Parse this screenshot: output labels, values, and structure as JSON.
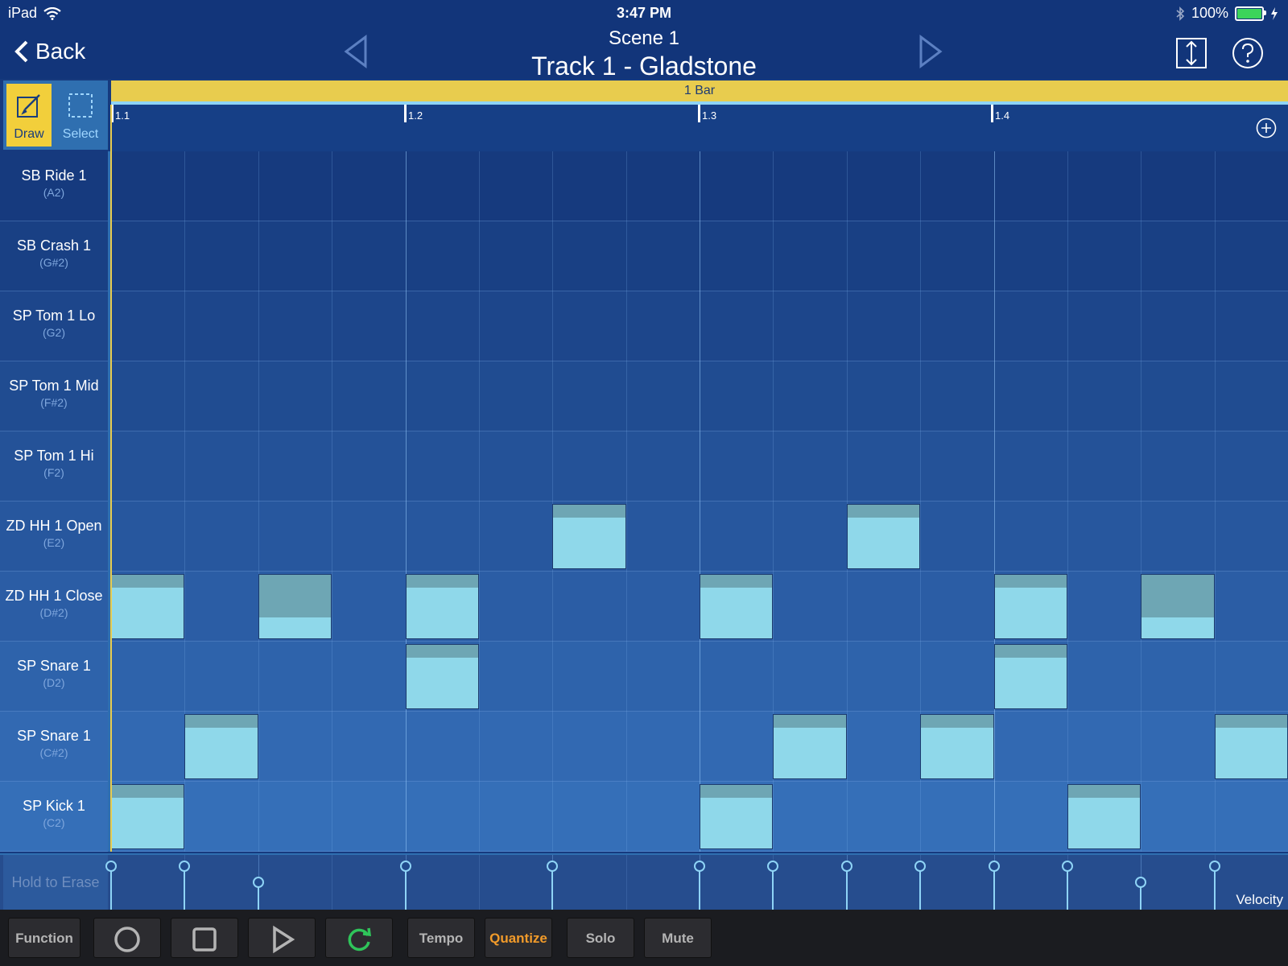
{
  "status": {
    "device": "iPad",
    "time": "3:47 PM",
    "battery": "100%"
  },
  "nav": {
    "back_label": "Back",
    "scene": "Scene  1",
    "track": "Track 1 - Gladstone"
  },
  "tools": {
    "draw_label": "Draw",
    "select_label": "Select"
  },
  "ruler": {
    "bar_label": "1 Bar",
    "beats": [
      "1.1",
      "1.2",
      "1.3",
      "1.4"
    ]
  },
  "lanes": [
    {
      "name": "SB Ride 1",
      "note": "(A2)"
    },
    {
      "name": "SB Crash 1",
      "note": "(G#2)"
    },
    {
      "name": "SP Tom 1 Lo",
      "note": "(G2)"
    },
    {
      "name": "SP Tom 1 Mid",
      "note": "(F#2)"
    },
    {
      "name": "SP Tom 1 Hi",
      "note": "(F2)"
    },
    {
      "name": "ZD HH 1 Open",
      "note": "(E2)"
    },
    {
      "name": "ZD HH 1 Close",
      "note": "(D#2)"
    },
    {
      "name": "SP Snare 1",
      "note": "(D2)"
    },
    {
      "name": "SP Snare 1",
      "note": "(C#2)"
    },
    {
      "name": "SP Kick 1",
      "note": "(C2)"
    }
  ],
  "notes": [
    {
      "lane": 5,
      "step": 6,
      "velocity": 0.8
    },
    {
      "lane": 5,
      "step": 10,
      "velocity": 0.8
    },
    {
      "lane": 6,
      "step": 0,
      "velocity": 0.8
    },
    {
      "lane": 6,
      "step": 2,
      "velocity": 0.35
    },
    {
      "lane": 6,
      "step": 4,
      "velocity": 0.8
    },
    {
      "lane": 6,
      "step": 8,
      "velocity": 0.8
    },
    {
      "lane": 6,
      "step": 12,
      "velocity": 0.8
    },
    {
      "lane": 6,
      "step": 14,
      "velocity": 0.35
    },
    {
      "lane": 7,
      "step": 4,
      "velocity": 0.8
    },
    {
      "lane": 7,
      "step": 12,
      "velocity": 0.8
    },
    {
      "lane": 8,
      "step": 1,
      "velocity": 0.8
    },
    {
      "lane": 8,
      "step": 9,
      "velocity": 0.8
    },
    {
      "lane": 8,
      "step": 11,
      "velocity": 0.8
    },
    {
      "lane": 8,
      "step": 15,
      "velocity": 0.8
    },
    {
      "lane": 9,
      "step": 0,
      "velocity": 0.8
    },
    {
      "lane": 9,
      "step": 8,
      "velocity": 0.8
    },
    {
      "lane": 9,
      "step": 13,
      "velocity": 0.8
    }
  ],
  "velocity_lane": {
    "erase_label": "Hold to Erase",
    "label": "Velocity",
    "levels": [
      0.8,
      0.8,
      0.5,
      0,
      0.8,
      0,
      0.8,
      0,
      0.8,
      0.8,
      0.8,
      0.8,
      0.8,
      0.8,
      0.5,
      0.8
    ]
  },
  "bottom_bar": {
    "function": "Function",
    "tempo": "Tempo",
    "quantize": "Quantize",
    "solo": "Solo",
    "mute": "Mute"
  },
  "colors": {
    "accent_yellow": "#f2cf3b",
    "note": "#8fd8ea",
    "note_velocity": "#6ea6b4",
    "loop_green": "#2fc45a",
    "quantize_orange": "#f29b2a"
  }
}
